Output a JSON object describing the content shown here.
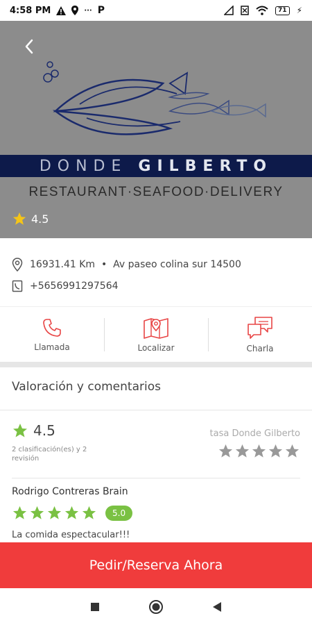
{
  "status_bar": {
    "time": "4:58 PM",
    "battery": "71"
  },
  "restaurant": {
    "brand_first": "DONDE ",
    "brand_second": "GILBERTO",
    "tagline": "RESTAURANT·SEAFOOD·DELIVERY",
    "rating": "4.5"
  },
  "info": {
    "location": "16931.41 Km  •  Av paseo colina sur 14500",
    "phone": "+5656991297564"
  },
  "actions": [
    {
      "label": "Llamada",
      "icon": "phone-icon"
    },
    {
      "label": "Localizar",
      "icon": "map-icon"
    },
    {
      "label": "Charla",
      "icon": "chat-icon"
    }
  ],
  "reviews": {
    "section_title": "Valoración y comentarios",
    "average": "4.5",
    "count_text": "2 clasificación(es) y 2 revisión",
    "rate_label": "tasa Donde Gilberto",
    "items": [
      {
        "name": "Rodrigo Contreras Brain",
        "score": "5.0",
        "comment": "La comida espectacular!!!"
      }
    ]
  },
  "cta": {
    "label": "Pedir/Reserva Ahora"
  },
  "colors": {
    "accent": "#f03c3c",
    "star_yellow": "#f5c518",
    "star_green": "#7ac143",
    "navy": "#0d1a4a"
  }
}
